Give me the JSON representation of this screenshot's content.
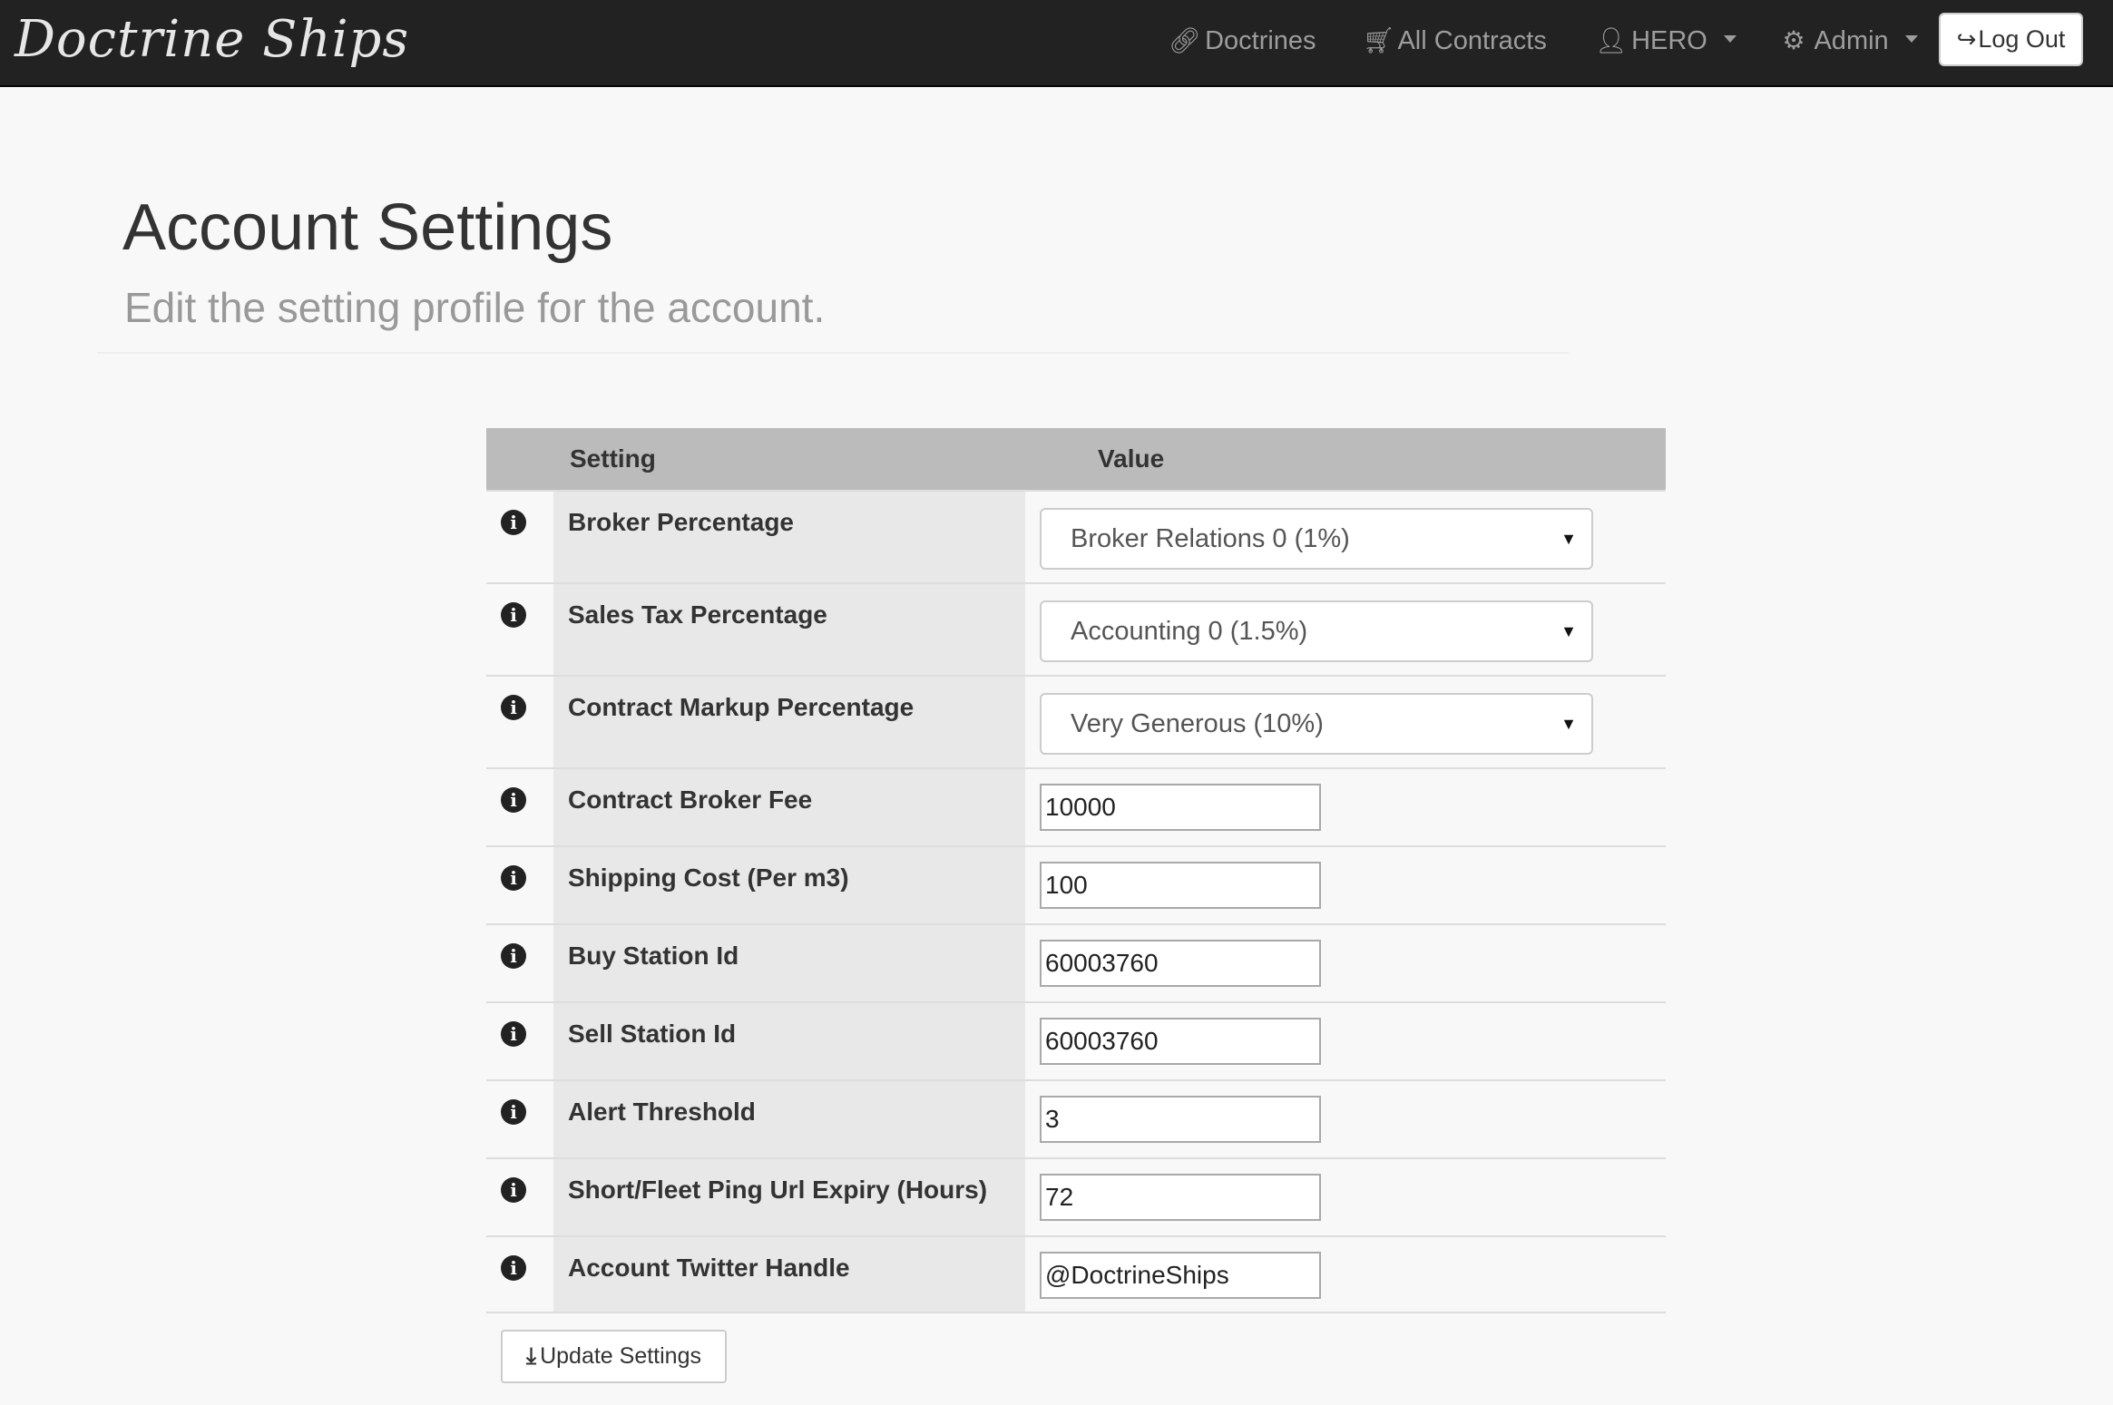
{
  "navbar": {
    "brand": "Doctrine Ships",
    "items": [
      {
        "label": "Doctrines",
        "icon": "link-icon",
        "glyph": "🔗"
      },
      {
        "label": "All Contracts",
        "icon": "cart-icon",
        "glyph": "🛒"
      },
      {
        "label": "HERO",
        "icon": "user-icon",
        "glyph": "👤"
      },
      {
        "label": "Admin",
        "icon": "gear-icon",
        "glyph": "⚙"
      }
    ],
    "logout_label": "Log Out"
  },
  "header": {
    "title": "Account Settings",
    "subtitle": "Edit the setting profile for the account."
  },
  "table": {
    "col_setting": "Setting",
    "col_value": "Value",
    "rows": [
      {
        "label": "Broker Percentage",
        "type": "select",
        "value": "Broker Relations 0 (1%)"
      },
      {
        "label": "Sales Tax Percentage",
        "type": "select",
        "value": "Accounting 0 (1.5%)"
      },
      {
        "label": "Contract Markup Percentage",
        "type": "select",
        "value": "Very Generous (10%)"
      },
      {
        "label": "Contract Broker Fee",
        "type": "input",
        "value": "10000"
      },
      {
        "label": "Shipping Cost (Per m3)",
        "type": "input",
        "value": "100"
      },
      {
        "label": "Buy Station Id",
        "type": "input",
        "value": "60003760"
      },
      {
        "label": "Sell Station Id",
        "type": "input",
        "value": "60003760"
      },
      {
        "label": "Alert Threshold",
        "type": "input",
        "value": "3"
      },
      {
        "label": "Short/Fleet Ping Url Expiry (Hours)",
        "type": "input",
        "value": "72"
      },
      {
        "label": "Account Twitter Handle",
        "type": "input",
        "value": "@DoctrineShips"
      }
    ]
  },
  "actions": {
    "update_label": "Update Settings"
  }
}
